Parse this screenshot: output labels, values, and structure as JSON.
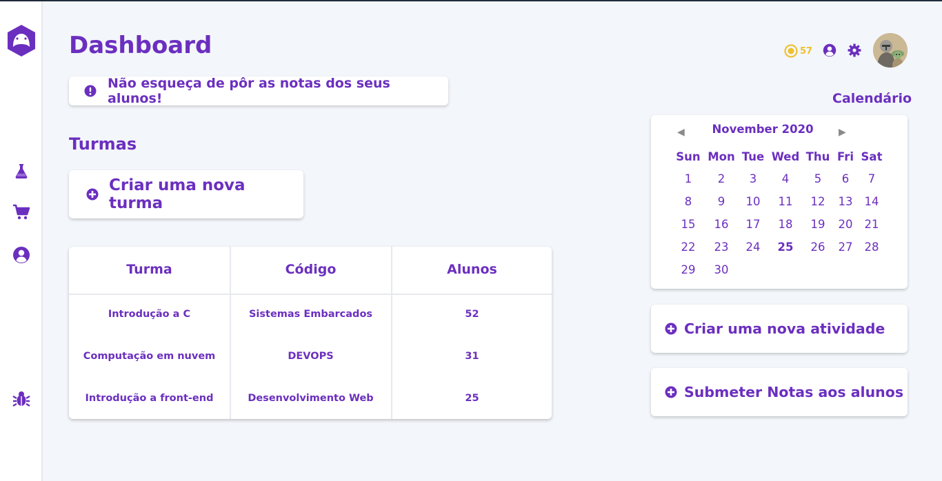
{
  "page": {
    "title": "Dashboard"
  },
  "alert": {
    "text": "Não esqueça de pôr as notas dos seus alunos!"
  },
  "classes": {
    "section_title": "Turmas",
    "create_label": "Criar uma nova turma",
    "columns": [
      "Turma",
      "Código",
      "Alunos"
    ],
    "rows": [
      [
        "Introdução a C",
        "Sistemas Embarcados",
        "52"
      ],
      [
        "Computação em nuvem",
        "DEVOPS",
        "31"
      ],
      [
        "Introdução a front-end",
        "Desenvolvimento Web",
        "25"
      ]
    ]
  },
  "topbar": {
    "coins": "57"
  },
  "calendar": {
    "title": "Calendário",
    "month_label": "November 2020",
    "prev_icon": "◀",
    "next_icon": "▶",
    "weekdays": [
      "Sun",
      "Mon",
      "Tue",
      "Wed",
      "Thu",
      "Fri",
      "Sat"
    ],
    "weeks": [
      [
        "1",
        "2",
        "3",
        "4",
        "5",
        "6",
        "7"
      ],
      [
        "8",
        "9",
        "10",
        "11",
        "12",
        "13",
        "14"
      ],
      [
        "15",
        "16",
        "17",
        "18",
        "19",
        "20",
        "21"
      ],
      [
        "22",
        "23",
        "24",
        "25",
        "26",
        "27",
        "28"
      ],
      [
        "29",
        "30"
      ]
    ],
    "today": "25"
  },
  "actions": {
    "create_activity": "Criar uma nova atividade",
    "submit_grades": "Submeter Notas aos alunos"
  },
  "icons": {
    "logo": "gamepad-logo-icon",
    "nav": [
      "flask-icon",
      "cart-icon",
      "user-circle-icon",
      "bug-icon"
    ],
    "alert": "exclamation-circle-icon",
    "add": "plus-circle-icon",
    "coin": "coin-icon",
    "profile": "user-circle-icon",
    "settings": "gear-icon"
  },
  "colors": {
    "accent": "#6b2fbf",
    "background": "#f3f6fa",
    "coin": "#f0c030"
  }
}
